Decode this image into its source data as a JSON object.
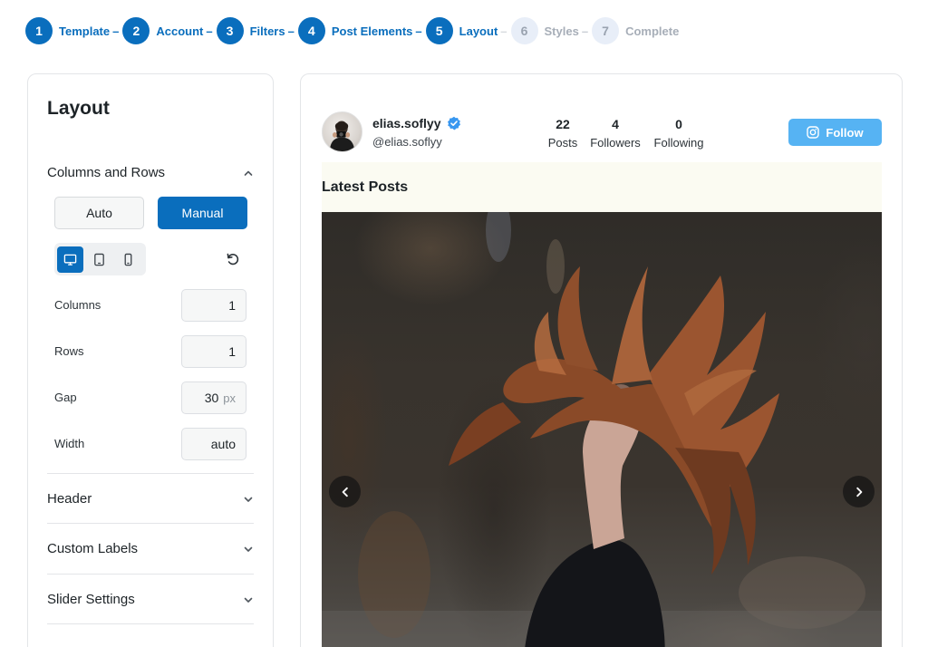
{
  "steps": [
    {
      "num": "1",
      "label": "Template",
      "state": "done"
    },
    {
      "num": "2",
      "label": "Account",
      "state": "done"
    },
    {
      "num": "3",
      "label": "Filters",
      "state": "done"
    },
    {
      "num": "4",
      "label": "Post Elements",
      "state": "done"
    },
    {
      "num": "5",
      "label": "Layout",
      "state": "current"
    },
    {
      "num": "6",
      "label": "Styles",
      "state": "upcoming"
    },
    {
      "num": "7",
      "label": "Complete",
      "state": "upcoming"
    }
  ],
  "step_separator": "–",
  "sidebar": {
    "title": "Layout",
    "columns_rows": {
      "heading": "Columns and Rows",
      "mode_auto": "Auto",
      "mode_manual": "Manual",
      "selected_mode": "Manual",
      "selected_device": "desktop",
      "fields": {
        "columns": {
          "label": "Columns",
          "value": "1"
        },
        "rows": {
          "label": "Rows",
          "value": "1"
        },
        "gap": {
          "label": "Gap",
          "value": "30",
          "unit": "px"
        },
        "width": {
          "label": "Width",
          "value": "auto"
        }
      }
    },
    "sections": {
      "header": "Header",
      "custom_labels": "Custom Labels",
      "slider_settings": "Slider Settings"
    }
  },
  "preview": {
    "profile": {
      "name": "elias.soflyy",
      "handle": "@elias.soflyy",
      "verified": true
    },
    "stats": {
      "posts": {
        "value": "22",
        "label": "Posts"
      },
      "followers": {
        "value": "4",
        "label": "Followers"
      },
      "following": {
        "value": "0",
        "label": "Following"
      }
    },
    "follow_label": "Follow",
    "latest_posts_title": "Latest Posts"
  },
  "colors": {
    "primary": "#0a6ebd",
    "follow": "#56b3f3",
    "verified": "#3897f0",
    "latest_bg": "#fbfbf2"
  }
}
